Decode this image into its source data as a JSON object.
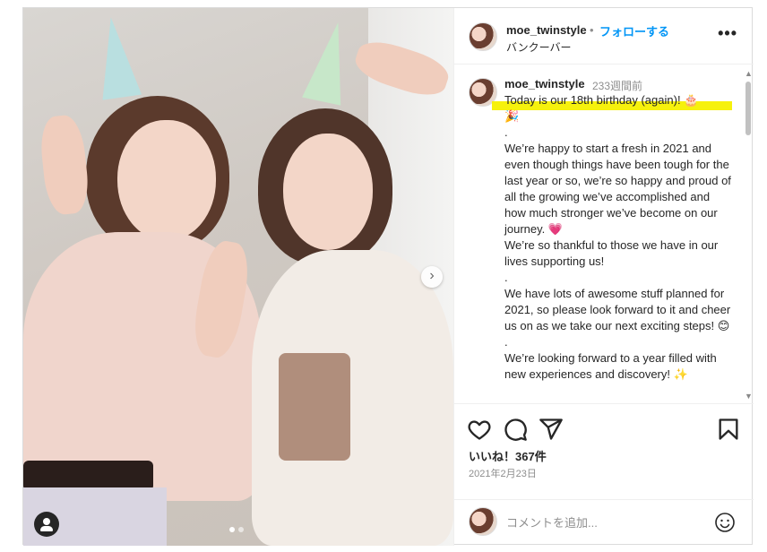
{
  "header": {
    "username": "moe_twinstyle",
    "separator": "•",
    "follow_label": "フォローする",
    "location": "バンクーバー",
    "more_label": "•••"
  },
  "caption": {
    "username": "moe_twinstyle",
    "time_ago": "233週間前",
    "lines": [
      "Today is our 18th birthday (again)! 🎂",
      "🎉",
      ".",
      "We’re happy to start a fresh in 2021 and even though things have been tough for the last year or so, we’re so happy and proud of all the growing we’ve accomplished and how much stronger we’ve become on our journey. 💗",
      "We’re so thankful to those we have in our lives supporting us!",
      ".",
      "We have lots of awesome stuff planned for 2021, so please look forward to it and cheer us on as we take our next exciting steps! 😊",
      ".",
      "We’re looking forward to a year filled with new experiences and discovery! ✨"
    ]
  },
  "media": {
    "next_button": "›",
    "slide_count": 2,
    "active_slide": 1
  },
  "icons": {
    "like": "heart-icon",
    "comment": "comment-icon",
    "share": "paper-plane-icon",
    "save": "bookmark-icon",
    "emoji": "smiley-icon",
    "user_tag": "user-icon",
    "more": "more-icon"
  },
  "likes_text": "いいね！367件",
  "date_text": "2021年2月23日",
  "comment_input": {
    "placeholder": "コメントを追加..."
  },
  "colors": {
    "accent": "#0095f6",
    "highlight": "#f5f000",
    "border": "#dbdbdb"
  }
}
